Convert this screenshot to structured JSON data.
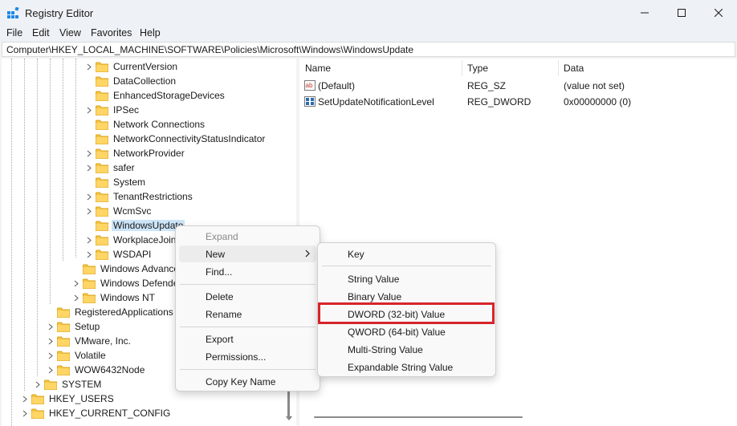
{
  "window": {
    "title": "Registry Editor",
    "icon": "registry-editor-icon",
    "accent": "#0067c0"
  },
  "menu": {
    "file": "File",
    "edit": "Edit",
    "view": "View",
    "favorites": "Favorites",
    "help": "Help"
  },
  "address": {
    "path": "Computer\\HKEY_LOCAL_MACHINE\\SOFTWARE\\Policies\\Microsoft\\Windows\\WindowsUpdate"
  },
  "tree": {
    "items": [
      {
        "label": "CurrentVersion"
      },
      {
        "label": "DataCollection"
      },
      {
        "label": "EnhancedStorageDevices"
      },
      {
        "label": "IPSec"
      },
      {
        "label": "Network Connections"
      },
      {
        "label": "NetworkConnectivityStatusIndicator"
      },
      {
        "label": "NetworkProvider"
      },
      {
        "label": "safer"
      },
      {
        "label": "System"
      },
      {
        "label": "TenantRestrictions"
      },
      {
        "label": "WcmSvc"
      },
      {
        "label": "WindowsUpdate"
      },
      {
        "label": "WorkplaceJoin"
      },
      {
        "label": "WSDAPI"
      },
      {
        "label": "Windows Advance"
      },
      {
        "label": "Windows Defende"
      },
      {
        "label": "Windows NT"
      },
      {
        "label": "RegisteredApplications"
      },
      {
        "label": "Setup"
      },
      {
        "label": "VMware, Inc."
      },
      {
        "label": "Volatile"
      },
      {
        "label": "WOW6432Node"
      },
      {
        "label": "SYSTEM"
      },
      {
        "label": "HKEY_USERS"
      },
      {
        "label": "HKEY_CURRENT_CONFIG"
      }
    ]
  },
  "list": {
    "headers": {
      "name": "Name",
      "type": "Type",
      "data": "Data"
    },
    "rows": [
      {
        "name": "(Default)",
        "type": "REG_SZ",
        "data": "(value not set)",
        "icon": "string-value-icon"
      },
      {
        "name": "SetUpdateNotificationLevel",
        "type": "REG_DWORD",
        "data": "0x00000000 (0)",
        "icon": "binary-value-icon"
      }
    ]
  },
  "context_menu": {
    "expand": "Expand",
    "new": "New",
    "find": "Find...",
    "delete": "Delete",
    "rename": "Rename",
    "export": "Export",
    "permissions": "Permissions...",
    "copy_key_name": "Copy Key Name"
  },
  "submenu": {
    "key": "Key",
    "string_value": "String Value",
    "binary_value": "Binary Value",
    "dword_value": "DWORD (32-bit) Value",
    "qword_value": "QWORD (64-bit) Value",
    "multi_string_value": "Multi-String Value",
    "expandable_string_value": "Expandable String Value"
  },
  "colors": {
    "selection": "#cce4f7",
    "highlight_border": "#d7242a",
    "folder": "#f5c542"
  }
}
